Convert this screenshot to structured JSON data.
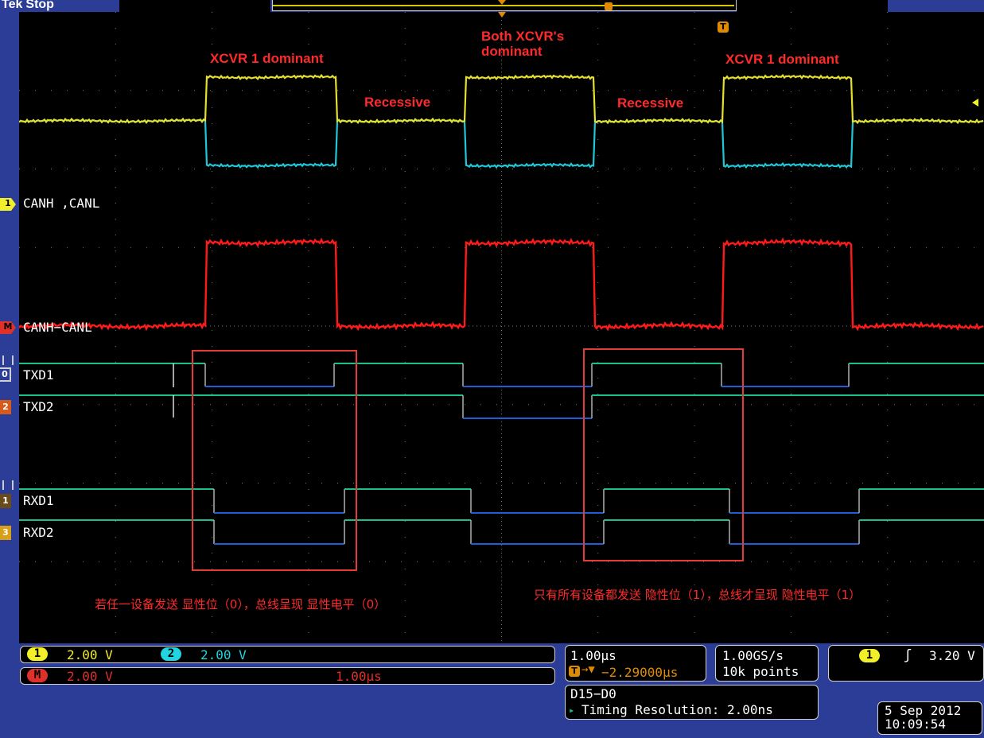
{
  "header": {
    "brand": "Tek",
    "status": "Stop"
  },
  "annotations": {
    "xcvr1_dominant_left": "XCVR 1 dominant",
    "recessive_left": "Recessive",
    "both_dominant": "Both XCVR's\ndominant",
    "recessive_right": "Recessive",
    "xcvr1_dominant_right": "XCVR 1 dominant",
    "note_left": "若任一设备发送 显性位（0），总线呈现 显性电平（0）",
    "note_right": "只有所有设备都发送 隐性位（1），总线才呈现 隐性电平（1）"
  },
  "channels": {
    "analog": {
      "marker": "1",
      "label": "CANH ,CANL"
    },
    "math": {
      "marker": "M",
      "label": "CANH−CANL"
    },
    "txd1": {
      "marker": "0",
      "label": "TXD1"
    },
    "txd2": {
      "marker": "2",
      "label": "TXD2"
    },
    "rxd1": {
      "marker": "1",
      "label": "RXD1"
    },
    "rxd2": {
      "marker": "3",
      "label": "RXD2"
    }
  },
  "status_bar": {
    "ch1": {
      "badge": "1",
      "scale": "2.00 V",
      "color": "#f2ee2a"
    },
    "ch2": {
      "badge": "2",
      "scale": "2.00 V",
      "color": "#22d3e0"
    },
    "math": {
      "badge": "M",
      "scale": "2.00 V",
      "time": "1.00μs",
      "color": "#e0302a"
    },
    "timebase": "1.00μs",
    "trigger_pos": "−2.29000μs",
    "sample_rate": "1.00GS/s",
    "record_length": "10k points",
    "digital": "D15−D0",
    "timing_resolution": "Timing Resolution: 2.00ns",
    "trigger": {
      "badge": "1",
      "slope": "ʃ",
      "level": "3.20 V"
    },
    "date": "5 Sep 2012",
    "time": "10:09:54"
  },
  "colors": {
    "canh": "#e6e02a",
    "canl": "#1fc8d8",
    "math": "#ff1a1a",
    "digital_high": "#19c08a",
    "digital_low": "#1e5fd6",
    "annotation": "#ff2a2a",
    "grid": "#7a7a7a"
  }
}
